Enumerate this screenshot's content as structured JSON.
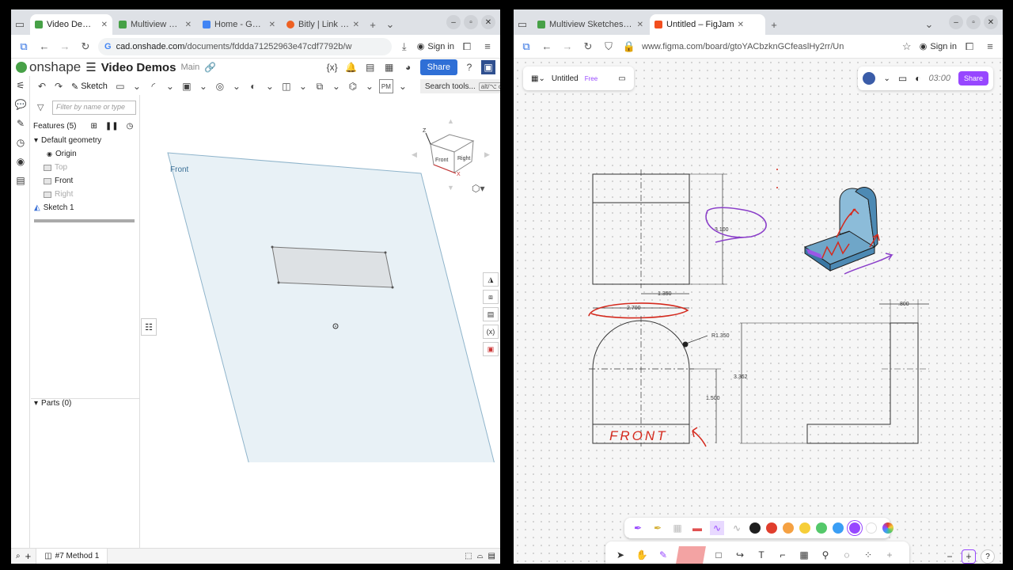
{
  "left_browser": {
    "tabs": [
      {
        "label": "Video Demos | ⁄",
        "active": true,
        "color": "#47a147"
      },
      {
        "label": "Multiview Demo",
        "active": false,
        "color": "#47a147"
      },
      {
        "label": "Home - Google",
        "active": false,
        "color": "#4285f4"
      },
      {
        "label": "Bitly | Link Dash",
        "active": false,
        "color": "#ee6123"
      }
    ],
    "url_domain": "cad.onshade.com",
    "url_path": "/documents/fddda71252963e47cdf7792b/w",
    "sign_in": "Sign in"
  },
  "onshape": {
    "logo": "onshape",
    "doc_title": "Video Demos",
    "branch": "Main",
    "share_label": "Share",
    "sketch_label": "Sketch",
    "search_tools": "Search tools...",
    "search_kbd": "alt/⌥ c",
    "filter_placeholder": "Filter by name or type",
    "features_label": "Features (5)",
    "tree": [
      {
        "label": "Default geometry",
        "dim": false,
        "indent": 0,
        "type": "group"
      },
      {
        "label": "Origin",
        "dim": false,
        "indent": 1,
        "type": "origin"
      },
      {
        "label": "Top",
        "dim": true,
        "indent": 1,
        "type": "plane"
      },
      {
        "label": "Front",
        "dim": false,
        "indent": 1,
        "type": "plane"
      },
      {
        "label": "Right",
        "dim": true,
        "indent": 1,
        "type": "plane"
      },
      {
        "label": "Sketch 1",
        "dim": false,
        "indent": 0,
        "type": "sketch"
      }
    ],
    "parts_label": "Parts (0)",
    "plane_label": "Front",
    "viewcube": {
      "front": "Front",
      "right": "Right",
      "z": "Z",
      "x": "X"
    },
    "bottom_tab": "#7 Method 1",
    "pm_label": "PM"
  },
  "right_browser": {
    "tabs": [
      {
        "label": "Multiview Sketches to Pr",
        "active": false,
        "color": "#47a147"
      },
      {
        "label": "Untitled – FigJam",
        "active": true,
        "color": "#f24e1e"
      }
    ],
    "url": "www.figma.com/board/gtoYACbzknGCfeaslHy2rr/Un",
    "sign_in": "Sign in"
  },
  "figjam": {
    "file_name": "Untitled",
    "plan": "Free",
    "timer": "03:00",
    "share_label": "Share",
    "dims": {
      "d1": "3.100",
      "d2": "1.350",
      "d3": "2.700",
      "d4": ".800",
      "d5": "R1.350",
      "d6": "3.362",
      "d7": "1.500"
    },
    "front_text": "FRONT",
    "colors": [
      "#1e1e1e",
      "#e03e2d",
      "#f5a142",
      "#f6ce38",
      "#54c86a",
      "#3a9ef5",
      "#9747ff",
      "#ffffff"
    ]
  }
}
